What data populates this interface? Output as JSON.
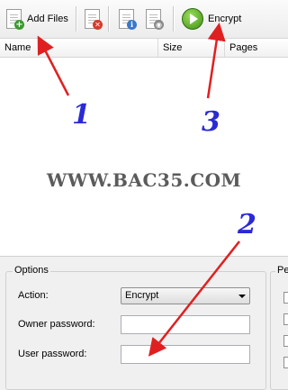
{
  "toolbar": {
    "add_files_label": "Add Files",
    "encrypt_label": "Encrypt"
  },
  "list": {
    "columns": [
      "Name",
      "Size",
      "Pages"
    ]
  },
  "watermark": "WWW.BAC35.COM",
  "options": {
    "title": "Options",
    "action_label": "Action:",
    "action_value": "Encrypt",
    "owner_password_label": "Owner password:",
    "user_password_label": "User password:",
    "owner_password_value": "",
    "user_password_value": ""
  },
  "permissions": {
    "title_partial": "Pe"
  },
  "annotations": {
    "step1": "1",
    "step2": "2",
    "step3": "3",
    "color": "#2a2ad6",
    "arrow_color": "#e02020"
  }
}
